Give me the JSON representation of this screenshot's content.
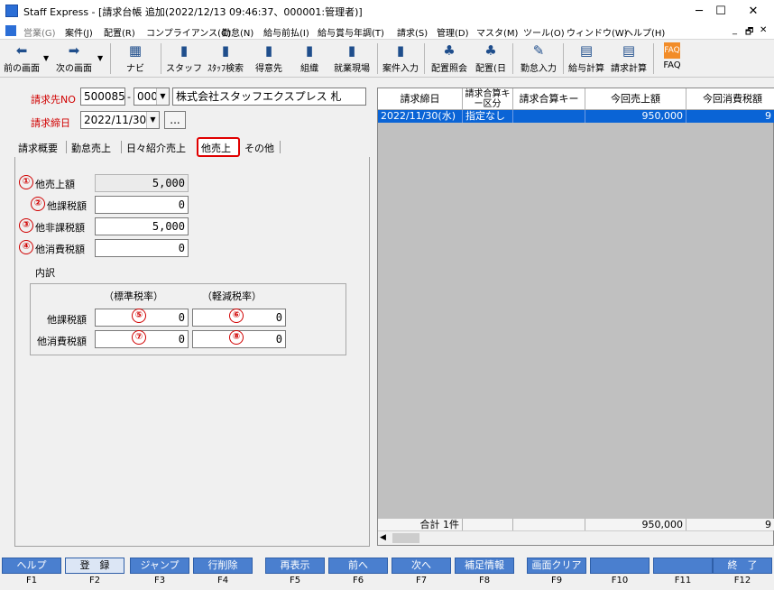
{
  "window": {
    "title": "Staff Express - [請求台帳 追加(2022/12/13 09:46:37、000001:管理者)]",
    "minimize": "─",
    "maximize": "☐",
    "close": "✕"
  },
  "menu": [
    "営業(G)",
    "案件(J)",
    "配置(R)",
    "コンプライアンス(C)",
    "勤怠(N)",
    "給与前払(I)",
    "給与賞与年調(T)",
    "請求(S)",
    "管理(D)",
    "マスタ(M)",
    "ツール(O)",
    "ウィンドウ(W)",
    "ヘルプ(H)"
  ],
  "mdi_controls": [
    "_",
    "🗗",
    "✕"
  ],
  "toolbar": {
    "prev": "前の画面",
    "next": "次の画面",
    "navi": "ナビ",
    "staff": "スタッフ",
    "staff_search": "ｽﾀｯﾌ検索",
    "client": "得意先",
    "org": "組織",
    "site": "就業現場",
    "case_input": "案件入力",
    "placement_view": "配置照会",
    "placement_day": "配置(日",
    "attendance": "勤怠入力",
    "payroll": "給与計算",
    "billing": "請求計算",
    "faq": "FAQ"
  },
  "form": {
    "billing_no_label": "請求先NO",
    "billing_no": "500085",
    "billing_sub": "000",
    "company": "株式会社スタッフエクスプレス 札",
    "close_date_label": "請求締日",
    "close_date": "2022/11/30",
    "dots": "..."
  },
  "tabs": [
    "請求概要",
    "勤怠売上",
    "日々紹介売上",
    "他売上",
    "その他"
  ],
  "fields": {
    "other_sales_label": "他売上額",
    "other_sales": "5,000",
    "other_taxable_label": "他課税額",
    "other_taxable": "0",
    "other_nontaxable_label": "他非課税額",
    "other_nontaxable": "5,000",
    "other_tax_label": "他消費税額",
    "other_tax": "0"
  },
  "breakdown": {
    "title": "内訳",
    "std_rate": "（標準税率）",
    "reduced_rate": "（軽減税率）",
    "taxable_label": "他課税額",
    "tax_label": "他消費税額",
    "taxable_std": "0",
    "taxable_reduced": "0",
    "tax_std": "0",
    "tax_reduced": "0"
  },
  "markers": [
    "①",
    "②",
    "③",
    "④",
    "⑤",
    "⑥",
    "⑦",
    "⑧"
  ],
  "grid": {
    "headers": [
      "請求締日",
      "請求合算キー区分",
      "請求合算キー",
      "今回売上額",
      "今回消費税額"
    ],
    "row": [
      "2022/11/30(水)",
      "指定なし",
      "",
      "950,000",
      "9"
    ],
    "total": [
      "合計 1件",
      "",
      "",
      "950,000",
      "9"
    ],
    "scroll_left": "◀"
  },
  "fkeys": [
    {
      "label": "ヘルプ",
      "key": "F1"
    },
    {
      "label": "登　録",
      "key": "F2"
    },
    {
      "label": "ジャンプ",
      "key": "F3"
    },
    {
      "label": "行削除",
      "key": "F4"
    },
    {
      "label": "再表示",
      "key": "F5"
    },
    {
      "label": "前へ",
      "key": "F6"
    },
    {
      "label": "次へ",
      "key": "F7"
    },
    {
      "label": "補足情報",
      "key": "F8"
    },
    {
      "label": "画面クリア",
      "key": "F9"
    },
    {
      "label": "",
      "key": "F10"
    },
    {
      "label": "",
      "key": "F11"
    },
    {
      "label": "終　了",
      "key": "F12"
    }
  ],
  "colors": {
    "accent_red": "#d00000",
    "grid_select": "#0a64d6",
    "fkey_blue": "#4a7fcf"
  }
}
